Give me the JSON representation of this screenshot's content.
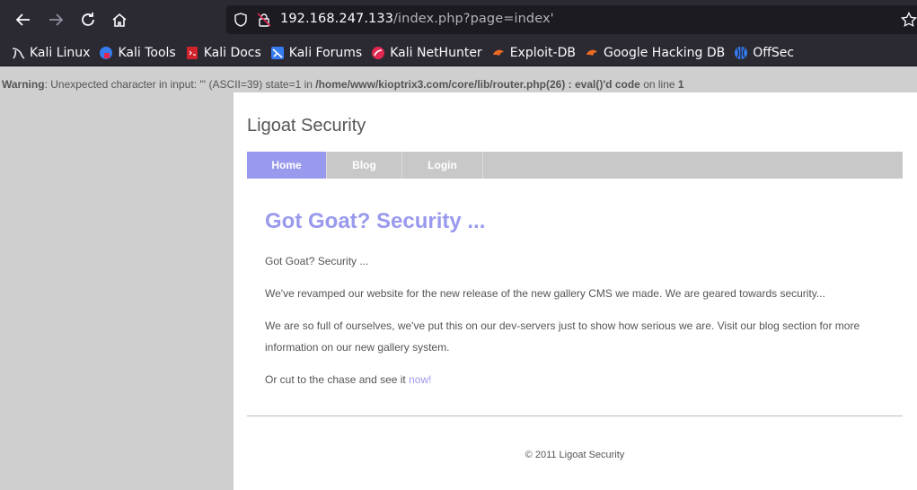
{
  "browser": {
    "url_host": "192.168.247.133",
    "url_path": "/index.php?page=index'",
    "bookmarks": [
      {
        "label": "Kali Linux",
        "icon": "kali-dragon-icon"
      },
      {
        "label": "Kali Tools",
        "icon": "kali-tools-icon"
      },
      {
        "label": "Kali Docs",
        "icon": "kali-docs-icon"
      },
      {
        "label": "Kali Forums",
        "icon": "kali-forums-icon"
      },
      {
        "label": "Kali NetHunter",
        "icon": "nethunter-icon"
      },
      {
        "label": "Exploit-DB",
        "icon": "exploit-db-icon"
      },
      {
        "label": "Google Hacking DB",
        "icon": "ghdb-icon"
      },
      {
        "label": "OffSec",
        "icon": "offsec-icon"
      }
    ]
  },
  "warning": {
    "label": "Warning",
    "text": ": Unexpected character in input: ''' (ASCII=39) state=1 in ",
    "path": "/home/www/kioptrix3.com/core/lib/router.php(26) : eval()'d code",
    "on_line": " on line ",
    "line": "1"
  },
  "site": {
    "title": "Ligoat Security",
    "menu": [
      "Home",
      "Blog",
      "Login"
    ],
    "headline": "Got Goat? Security ...",
    "p1": "Got Goat? Security ...",
    "p2": "We've revamped our website for the new release of the new gallery CMS we made. We are geared towards security...",
    "p3": "We are so full of ourselves, we've put this on our dev-servers just to show how serious we are. Visit our blog section for more information on our new gallery system.",
    "p4": "Or cut to the chase and see it ",
    "p4_link": "now!",
    "footer": "© 2011 Ligoat Security"
  }
}
